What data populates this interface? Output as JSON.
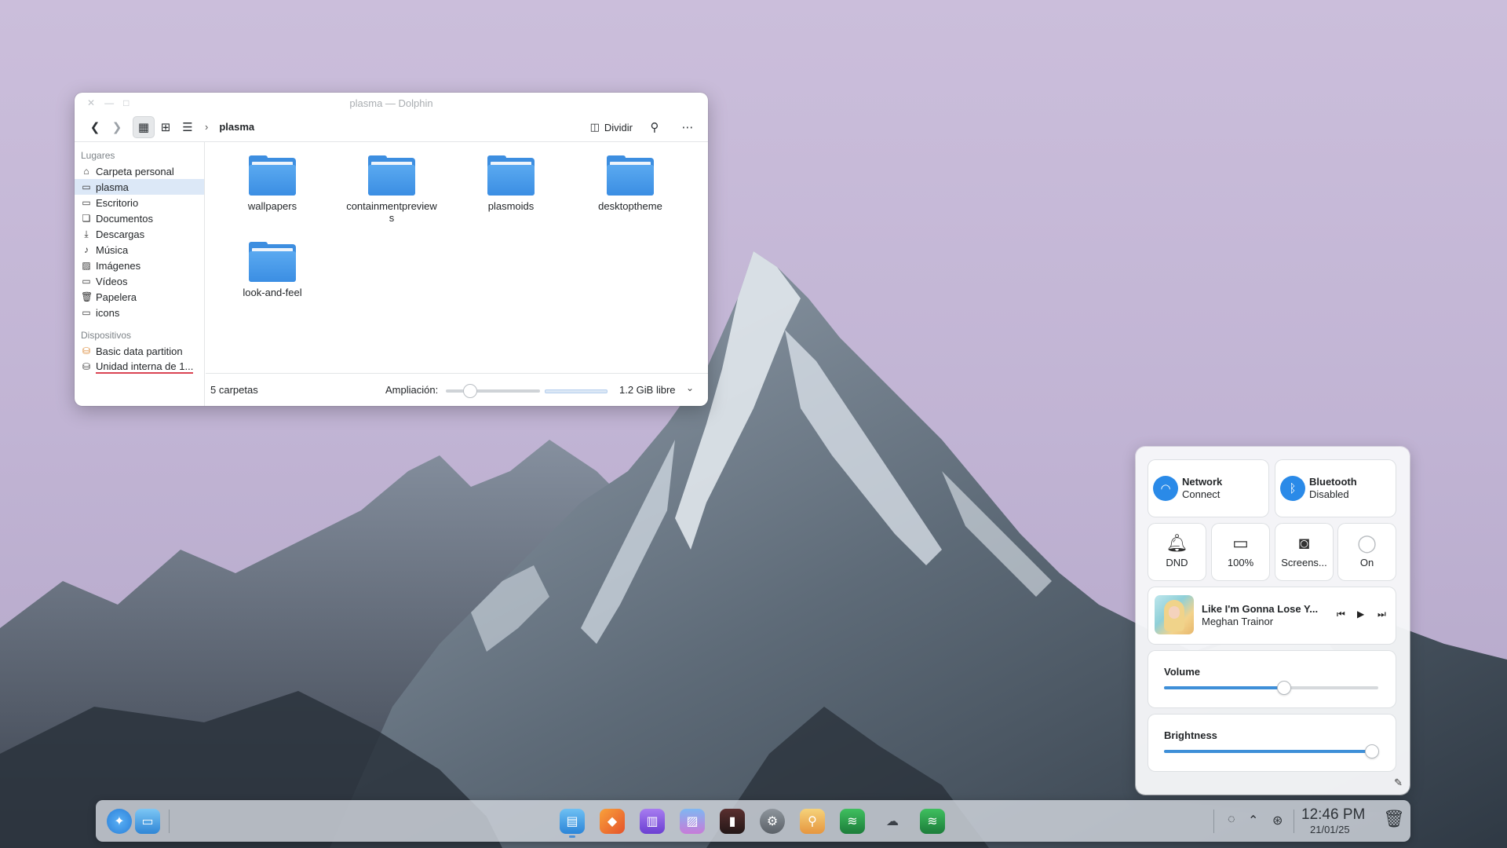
{
  "window": {
    "title": "plasma — Dolphin",
    "breadcrumb": "plasma",
    "split_label": "Dividir",
    "places_header": "Lugares",
    "places": [
      {
        "label": "Carpeta personal",
        "icon": "home-icon"
      },
      {
        "label": "plasma",
        "icon": "folder-icon",
        "selected": true
      },
      {
        "label": "Escritorio",
        "icon": "desktop-icon"
      },
      {
        "label": "Documentos",
        "icon": "documents-icon"
      },
      {
        "label": "Descargas",
        "icon": "download-icon"
      },
      {
        "label": "Música",
        "icon": "music-icon"
      },
      {
        "label": "Imágenes",
        "icon": "image-icon"
      },
      {
        "label": "Vídeos",
        "icon": "video-icon"
      },
      {
        "label": "Papelera",
        "icon": "trash-icon"
      },
      {
        "label": "icons",
        "icon": "folder-icon"
      }
    ],
    "devices_header": "Dispositivos",
    "devices": [
      {
        "label": "Basic data partition",
        "icon": "drive-icon"
      },
      {
        "label": "Unidad interna de 1...",
        "icon": "drive-icon"
      }
    ],
    "folders": [
      "wallpapers",
      "containmentpreviews",
      "plasmoids",
      "desktoptheme",
      "look-and-feel"
    ],
    "status": {
      "count": "5 carpetas",
      "zoom_label": "Ampliación:",
      "free_space": "1.2 GiB libre"
    }
  },
  "control_center": {
    "network": {
      "title": "Network",
      "subtitle": "Connect"
    },
    "bluetooth": {
      "title": "Bluetooth",
      "subtitle": "Disabled"
    },
    "toggles": [
      {
        "label": "DND",
        "icon": "bell-icon"
      },
      {
        "label": "100%",
        "icon": "battery-icon"
      },
      {
        "label": "Screens...",
        "icon": "camera-icon"
      },
      {
        "label": "On",
        "icon": "lightbulb-icon"
      }
    ],
    "media": {
      "title": "Like I'm Gonna Lose Y...",
      "artist": "Meghan Trainor"
    },
    "volume": {
      "label": "Volume",
      "value": 0.56
    },
    "brightness": {
      "label": "Brightness",
      "value": 0.97
    }
  },
  "panel": {
    "time": "12:46 PM",
    "date": "21/01/25"
  },
  "colors": {
    "accent": "#2a8ae8",
    "folder": "#3d8ee0",
    "selection": "#dce8f7"
  }
}
